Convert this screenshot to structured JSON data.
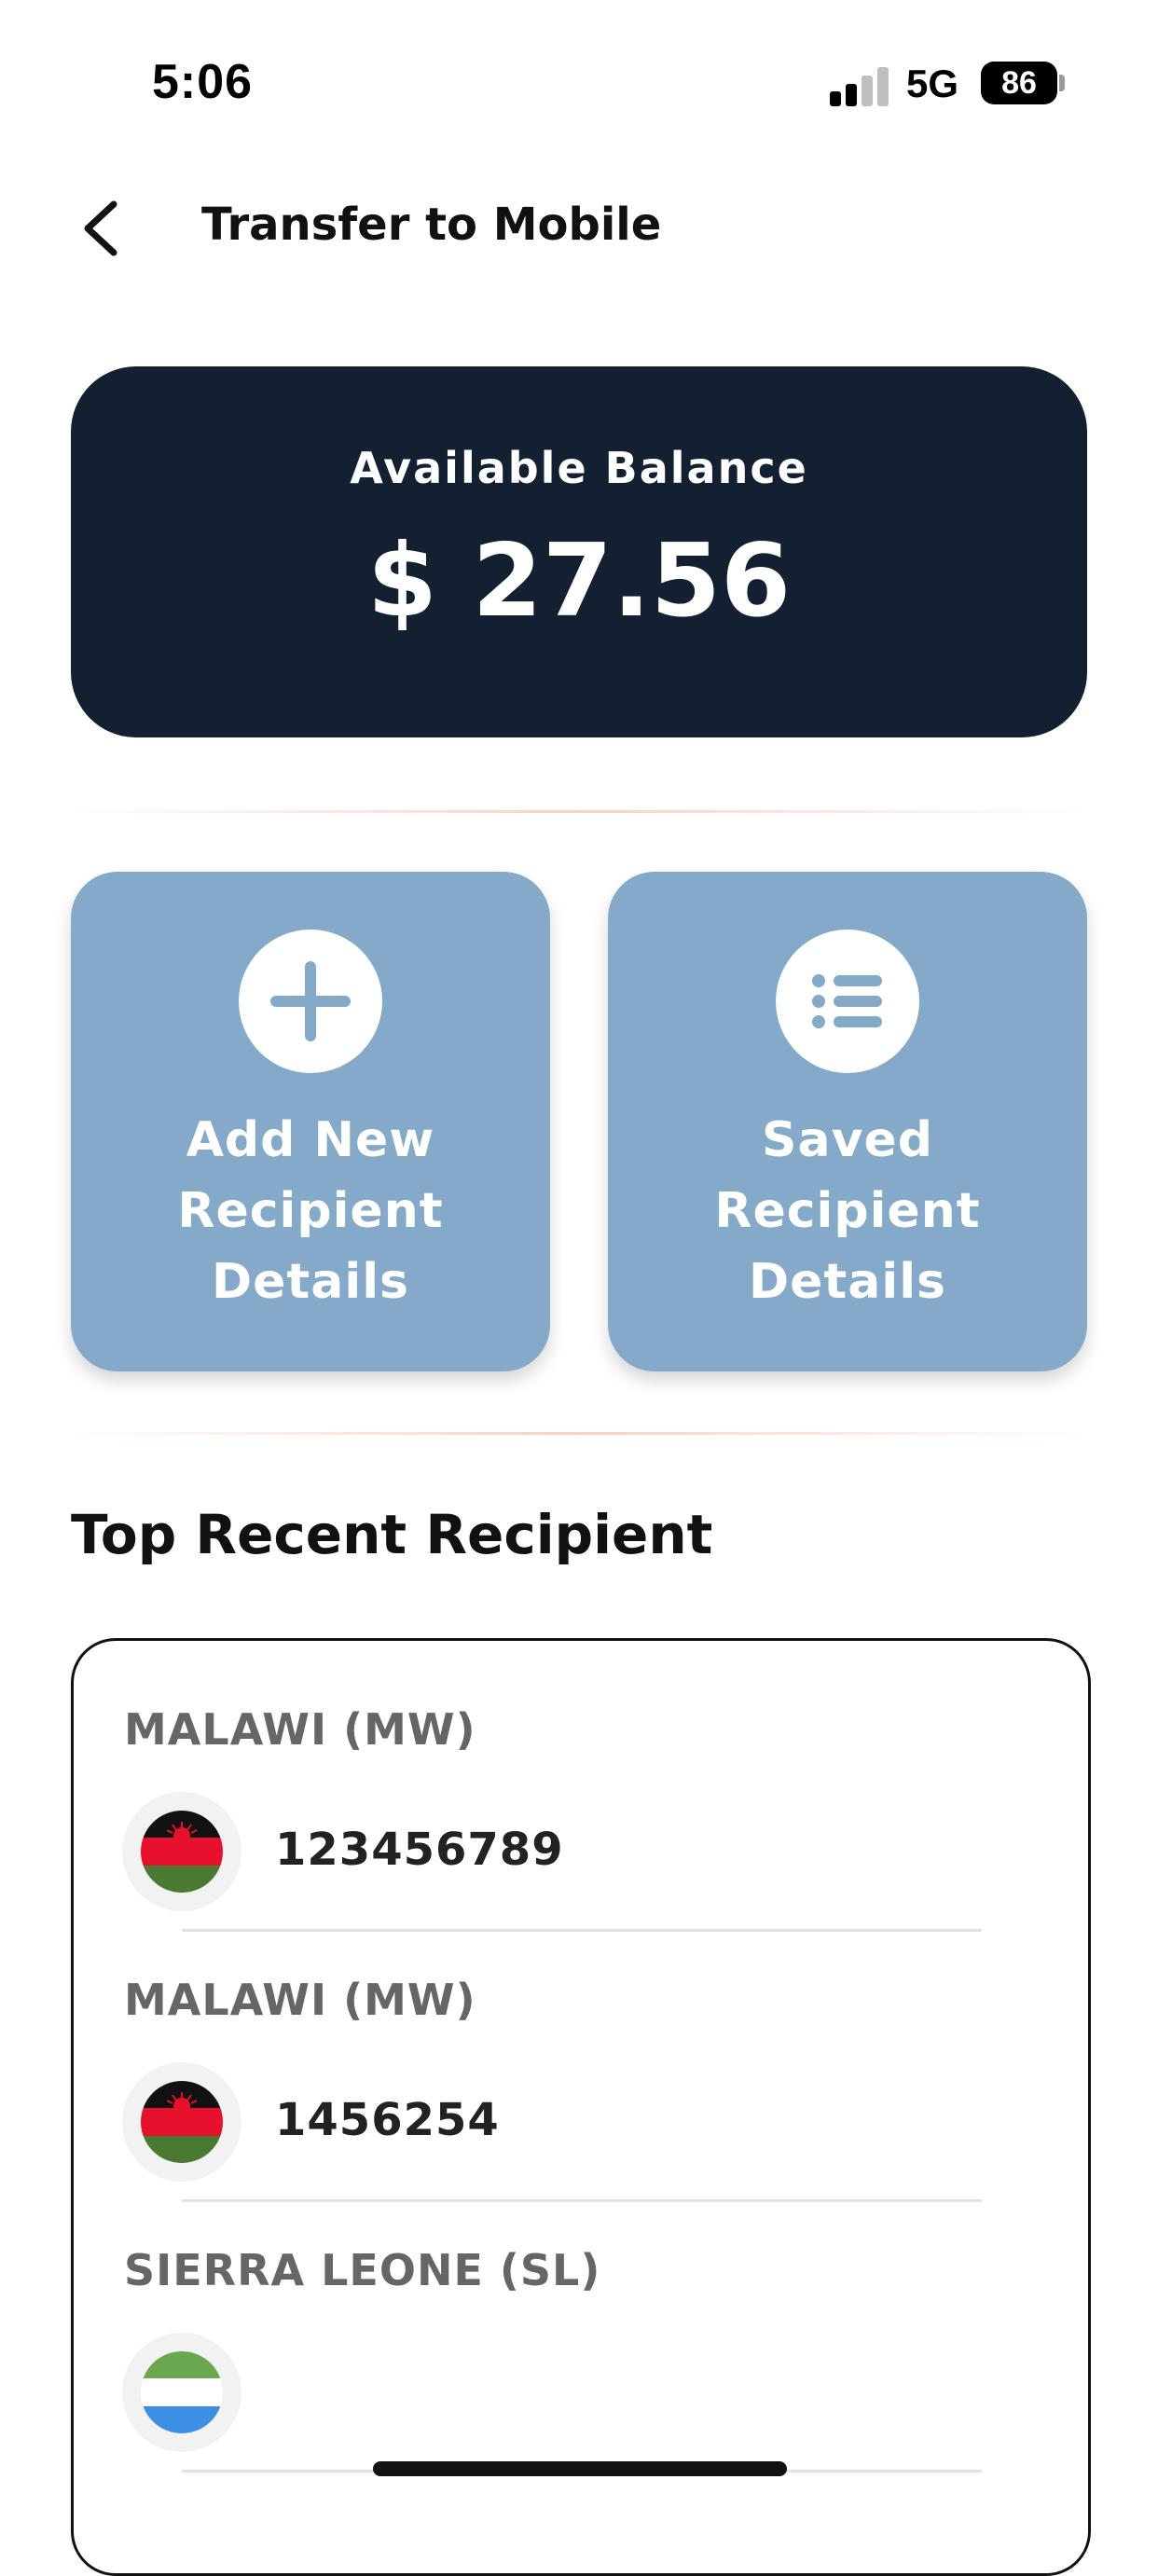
{
  "status_bar": {
    "time": "5:06",
    "network": "5G",
    "battery": "86"
  },
  "header": {
    "title": "Transfer to Mobile"
  },
  "balance": {
    "label": "Available Balance",
    "value": "$ 27.56"
  },
  "actions": [
    {
      "label": "Add New\nRecipient\nDetails",
      "icon": "plus-icon"
    },
    {
      "label": "Saved\nRecipient\nDetails",
      "icon": "list-icon"
    }
  ],
  "recent": {
    "title": "Top Recent Recipient",
    "items": [
      {
        "country": "MALAWI (MW)",
        "number": "123456789",
        "flag": "malawi-flag"
      },
      {
        "country": "MALAWI (MW)",
        "number": "1456254",
        "flag": "malawi-flag"
      },
      {
        "country": "SIERRA LEONE (SL)",
        "number": "",
        "flag": "sierra-leone-flag"
      }
    ]
  },
  "colors": {
    "balance_card": "#132031",
    "action_card": "#84a9c9",
    "malawi_black": "#111111",
    "malawi_red": "#e8112d",
    "malawi_green": "#4a7a32",
    "sierra_green": "#6aa84f",
    "sierra_white": "#ffffff",
    "sierra_blue": "#3d8fe6"
  }
}
